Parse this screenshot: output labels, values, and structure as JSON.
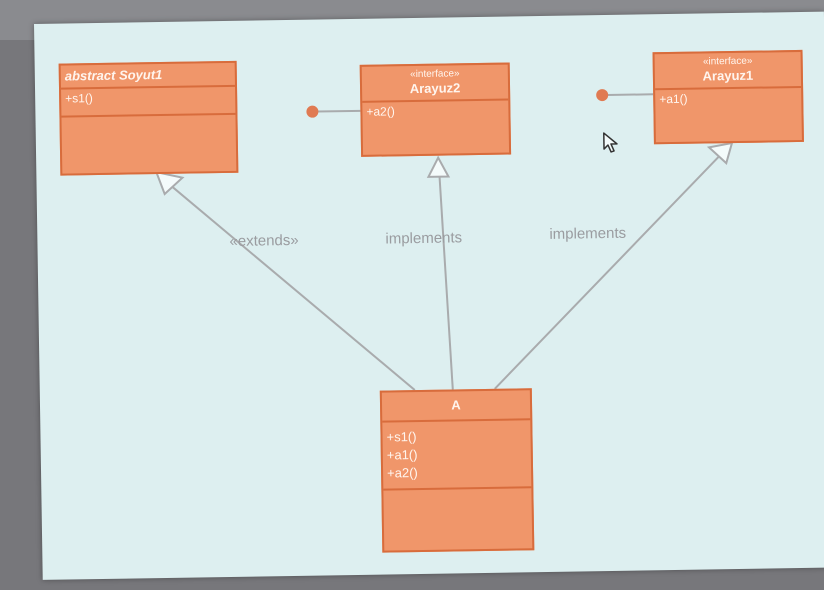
{
  "classes": {
    "soyut1": {
      "name": "abstract Soyut1",
      "operations": [
        "+s1()"
      ]
    },
    "arayuz2": {
      "stereotype": "«interface»",
      "name": "Arayuz2",
      "operations": [
        "+a2()"
      ]
    },
    "arayuz1": {
      "stereotype": "«interface»",
      "name": "Arayuz1",
      "operations": [
        "+a1()"
      ]
    },
    "a": {
      "name": "A",
      "operations": [
        "+s1()",
        "+a1()",
        "+a2()"
      ]
    }
  },
  "relations": {
    "extends_label": "«extends»",
    "implements2_label": "implements",
    "implements1_label": "implements"
  },
  "colors": {
    "class_fill": "#f0966a",
    "class_border": "#d86c3c",
    "line": "#a9abad",
    "lollipop": "#e07a52",
    "background": "#ddeff0"
  }
}
